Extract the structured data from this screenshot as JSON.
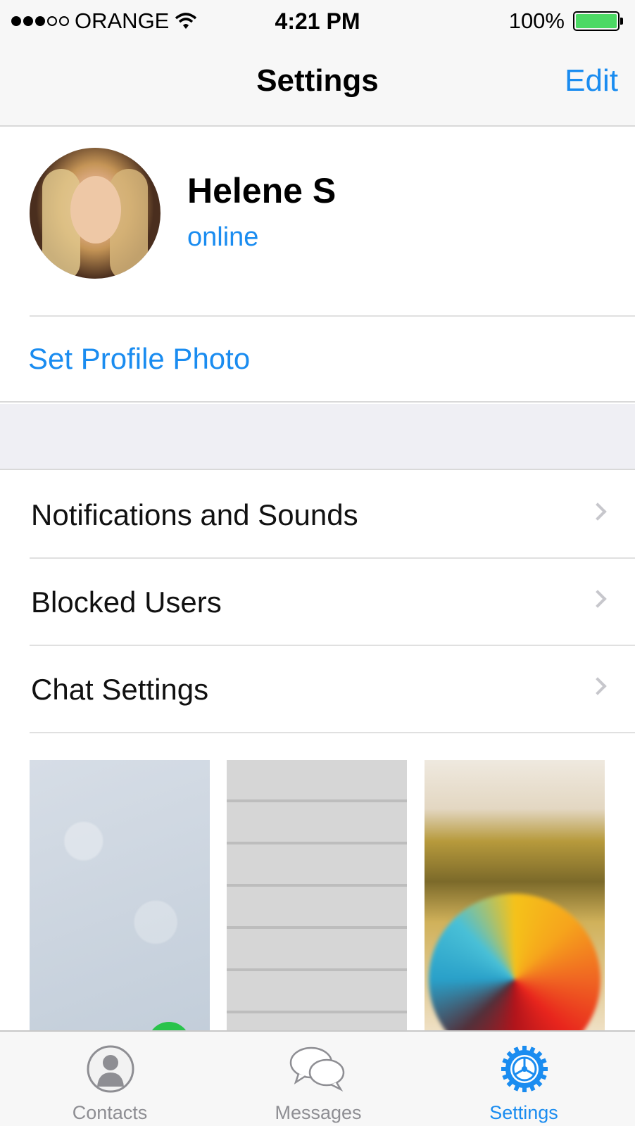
{
  "status_bar": {
    "carrier": "ORANGE",
    "time": "4:21 PM",
    "battery": "100%",
    "battery_level": 1.0
  },
  "nav": {
    "title": "Settings",
    "edit_label": "Edit"
  },
  "profile": {
    "name": "Helene S",
    "status": "online"
  },
  "set_photo_label": "Set Profile Photo",
  "list_items": [
    {
      "label": "Notifications and Sounds"
    },
    {
      "label": "Blocked Users"
    },
    {
      "label": "Chat Settings"
    }
  ],
  "tabs": [
    {
      "label": "Contacts",
      "icon": "contacts-icon"
    },
    {
      "label": "Messages",
      "icon": "messages-icon"
    },
    {
      "label": "Settings",
      "icon": "settings-gear-icon",
      "active": true
    }
  ],
  "colors": {
    "accent": "#1a8cf0",
    "battery": "#4cd964",
    "group_background": "#efeff4"
  }
}
